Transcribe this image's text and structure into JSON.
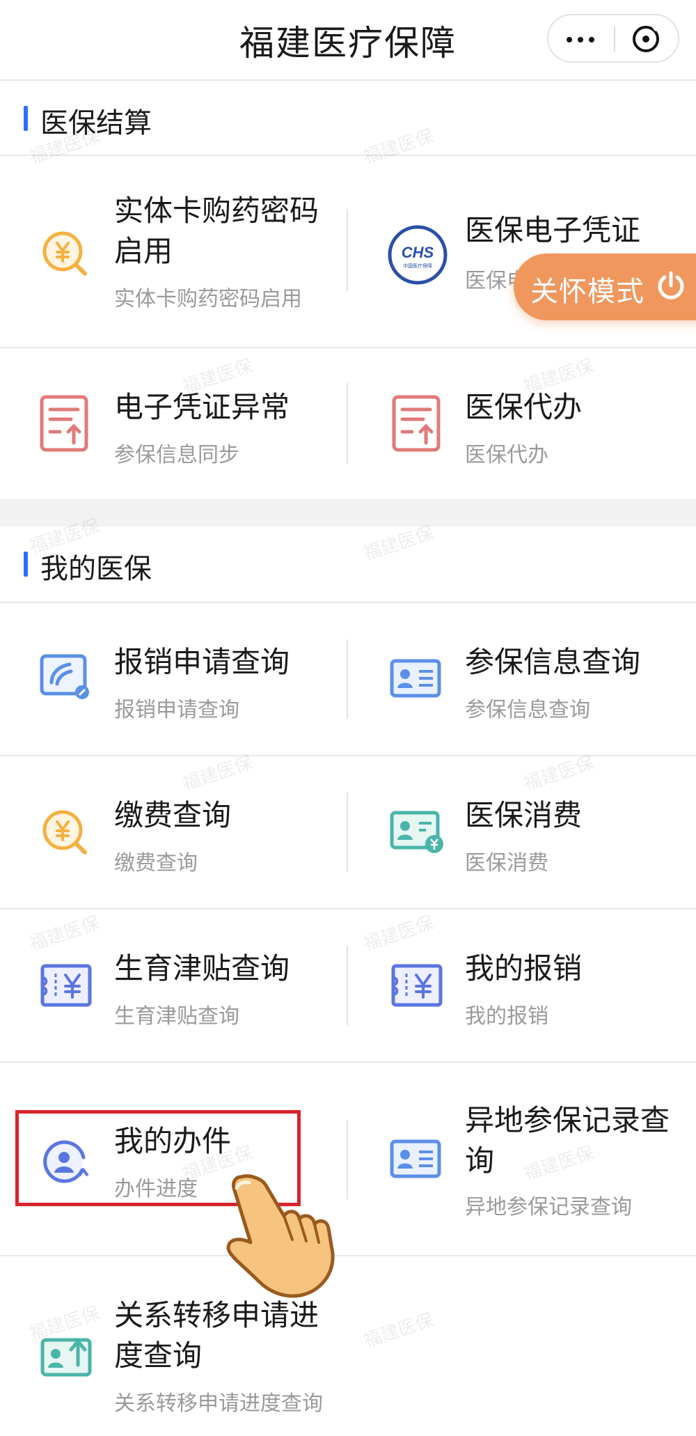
{
  "app": {
    "title": "福建医疗保障"
  },
  "care_mode": {
    "label": "关怀模式"
  },
  "watermark": "福建医保",
  "sections": {
    "settlement": {
      "title": "医保结算",
      "items": [
        {
          "title": "实体卡购药密码启用",
          "title_l1": "实体卡购药密码",
          "title_l2": "启用",
          "subtitle": "实体卡购药密码启用",
          "icon": "yuan-search-icon"
        },
        {
          "title": "医保电子凭证",
          "subtitle": "医保电",
          "icon": "chs-logo-icon",
          "logo_text": "CHS",
          "logo_subtext": "中国医疗保障"
        },
        {
          "title": "电子凭证异常",
          "subtitle": "参保信息同步",
          "icon": "document-upload-icon"
        },
        {
          "title": "医保代办",
          "subtitle": "医保代办",
          "icon": "document-upload-icon"
        }
      ]
    },
    "my_insurance": {
      "title": "我的医保",
      "items": [
        {
          "title": "报销申请查询",
          "subtitle": "报销申请查询",
          "icon": "reimburse-query-icon"
        },
        {
          "title": "参保信息查询",
          "subtitle": "参保信息查询",
          "icon": "id-card-icon"
        },
        {
          "title": "缴费查询",
          "subtitle": "缴费查询",
          "icon": "yuan-search-icon"
        },
        {
          "title": "医保消费",
          "subtitle": "医保消费",
          "icon": "card-yuan-icon"
        },
        {
          "title": "生育津贴查询",
          "subtitle": "生育津贴查询",
          "icon": "ticket-yuan-icon"
        },
        {
          "title": "我的报销",
          "subtitle": "我的报销",
          "icon": "ticket-yuan-icon"
        },
        {
          "title": "我的办件",
          "subtitle": "办件进度",
          "icon": "user-refresh-icon"
        },
        {
          "title": "异地参保记录查询",
          "title_l1": "异地参保记录查",
          "title_l2": "询",
          "subtitle": "异地参保记录查询",
          "icon": "id-card-icon"
        },
        {
          "title": "关系转移申请进度查询",
          "title_l1": "关系转移申请进",
          "title_l2": "度查询",
          "subtitle": "关系转移申请进度查询",
          "icon": "card-upload-icon"
        }
      ]
    }
  },
  "colors": {
    "accent": "#2f6ff5",
    "care_mode": "#f0975e",
    "highlight": "#d9252c",
    "icon_blue": "#5b8fe8",
    "icon_yellow": "#f5b041",
    "icon_red": "#e07a7a",
    "icon_teal": "#4bb5a8"
  }
}
